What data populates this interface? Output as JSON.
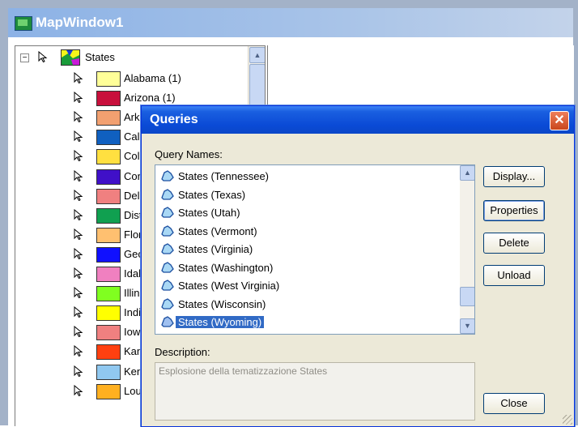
{
  "main_window": {
    "title": "MapWindow1"
  },
  "legend": {
    "layer": {
      "name": "States"
    },
    "categories": [
      {
        "label": "Alabama (1)",
        "color": "#ffff99"
      },
      {
        "label": "Arizona (1)",
        "color": "#c8103c"
      },
      {
        "label": "Arka",
        "color": "#f2a070"
      },
      {
        "label": "Calif",
        "color": "#1060c0"
      },
      {
        "label": "Colo",
        "color": "#ffe040"
      },
      {
        "label": "Conn",
        "color": "#4010c8"
      },
      {
        "label": "Dela",
        "color": "#f08080"
      },
      {
        "label": "Distr",
        "color": "#10a050"
      },
      {
        "label": "Flori",
        "color": "#ffc070"
      },
      {
        "label": "Geo",
        "color": "#1010ff"
      },
      {
        "label": "Idaho",
        "color": "#f080c0"
      },
      {
        "label": "Illino",
        "color": "#80ff20"
      },
      {
        "label": "India",
        "color": "#ffff00"
      },
      {
        "label": "Iowa",
        "color": "#f08080"
      },
      {
        "label": "Kans",
        "color": "#ff4010"
      },
      {
        "label": "Kent",
        "color": "#90c8f0"
      },
      {
        "label": "Louis",
        "color": "#ffb020"
      }
    ]
  },
  "dialog": {
    "title": "Queries",
    "close_glyph": "✕",
    "query_names_label": "Query Names:",
    "queries": [
      {
        "label": "States (Tennessee)"
      },
      {
        "label": "States (Texas)"
      },
      {
        "label": "States (Utah)"
      },
      {
        "label": "States (Vermont)"
      },
      {
        "label": "States (Virginia)"
      },
      {
        "label": "States (Washington)"
      },
      {
        "label": "States (West Virginia)"
      },
      {
        "label": "States (Wisconsin)"
      },
      {
        "label": "States (Wyoming)",
        "selected": true
      }
    ],
    "buttons": {
      "display": "Display...",
      "properties": "Properties",
      "delete": "Delete",
      "unload": "Unload",
      "close": "Close"
    },
    "description_label": "Description:",
    "description_text": "Esplosione della tematizzazione States"
  }
}
